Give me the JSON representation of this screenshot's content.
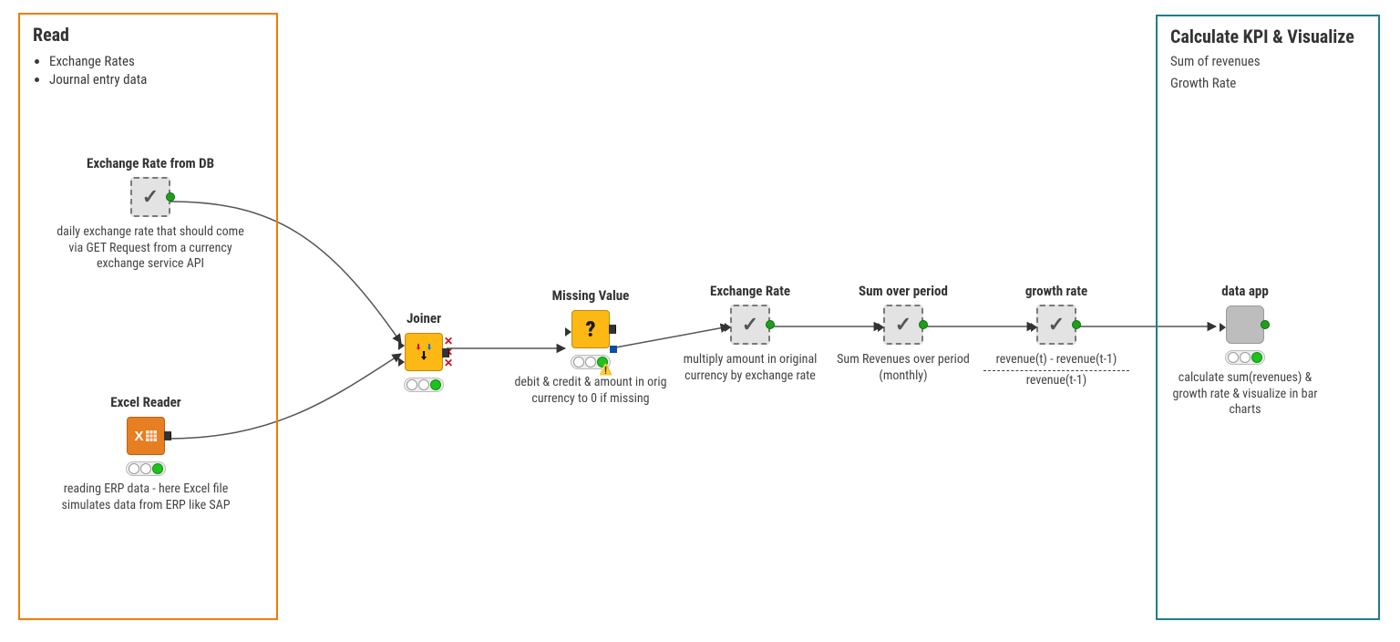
{
  "annotations": {
    "read": {
      "title": "Read",
      "bullet1": "Exchange Rates",
      "bullet2": "Journal entry data",
      "border_color": "#f47a00"
    },
    "kpi": {
      "title": "Calculate KPI & Visualize",
      "sub1": "Sum of revenues",
      "sub2": "Growth Rate",
      "border_color": "#1f7d8c"
    }
  },
  "nodes": {
    "exchange_db": {
      "title": "Exchange Rate from DB",
      "desc": "daily exchange rate that should come via GET Request from a currency exchange service API"
    },
    "excel_reader": {
      "title": "Excel Reader",
      "desc": "reading ERP data - here Excel file simulates data from ERP like SAP"
    },
    "joiner": {
      "title": "Joiner",
      "desc": ""
    },
    "missing_value": {
      "title": "Missing Value",
      "desc": "debit & credit & amount in orig currency to 0 if missing"
    },
    "exchange_rate": {
      "title": "Exchange Rate",
      "desc": "multiply amount in original currency by exchange rate"
    },
    "sum_period": {
      "title": "Sum over period",
      "desc": "Sum Revenues over period (monthly)"
    },
    "growth_rate": {
      "title": "growth rate",
      "desc_top": "revenue(t) - revenue(t-1)",
      "desc_bot": "revenue(t-1)"
    },
    "data_app": {
      "title": "data app",
      "desc": "calculate sum(revenues) & growth rate & visualize in bar charts"
    }
  }
}
